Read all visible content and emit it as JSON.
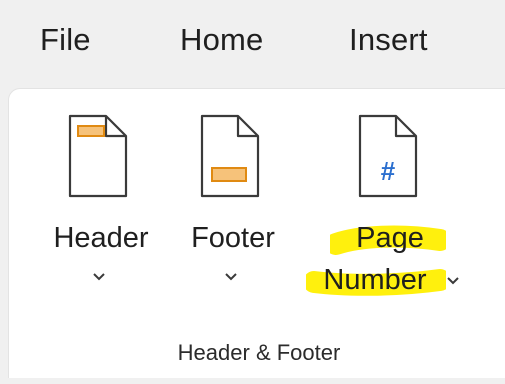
{
  "menu": {
    "file": "File",
    "home": "Home",
    "insert": "Insert"
  },
  "commands": {
    "header": {
      "label": "Header",
      "icon": "header-page-icon"
    },
    "footer": {
      "label": "Footer",
      "icon": "footer-page-icon"
    },
    "page_number": {
      "label_line1": "Page",
      "label_line2": "Number",
      "icon": "page-number-icon",
      "glyph": "#"
    }
  },
  "group": {
    "label": "Header & Footer"
  },
  "colors": {
    "accent_orange": "#e8a33a",
    "hash_blue": "#2b6fcf",
    "highlight_yellow": "#ffef00"
  }
}
